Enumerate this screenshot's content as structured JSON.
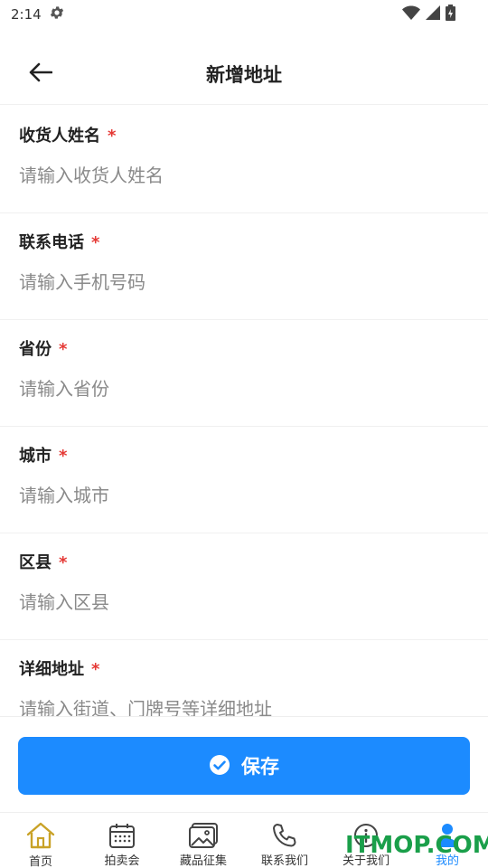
{
  "status_bar": {
    "time": "2:14"
  },
  "header": {
    "title": "新增地址"
  },
  "form": {
    "required_mark": "*",
    "fields": [
      {
        "label": "收货人姓名",
        "placeholder": "请输入收货人姓名",
        "value": ""
      },
      {
        "label": "联系电话",
        "placeholder": "请输入手机号码",
        "value": ""
      },
      {
        "label": "省份",
        "placeholder": "请输入省份",
        "value": ""
      },
      {
        "label": "城市",
        "placeholder": "请输入城市",
        "value": ""
      },
      {
        "label": "区县",
        "placeholder": "请输入区县",
        "value": ""
      },
      {
        "label": "详细地址",
        "placeholder": "请输入街道、门牌号等详细地址",
        "value": ""
      }
    ]
  },
  "save_button": {
    "label": "保存"
  },
  "tab_bar": {
    "tabs": [
      {
        "label": "首页",
        "icon": "home-icon"
      },
      {
        "label": "拍卖会",
        "icon": "calendar-icon"
      },
      {
        "label": "藏品征集",
        "icon": "image-icon"
      },
      {
        "label": "联系我们",
        "icon": "phone-icon"
      },
      {
        "label": "关于我们",
        "icon": "info-icon"
      },
      {
        "label": "我的",
        "icon": "user-icon",
        "active": true
      }
    ]
  },
  "watermark": "ITMOP.COM",
  "colors": {
    "accent": "#1c8bff",
    "required": "#e53935",
    "home_icon": "#c9a227",
    "watermark": "#1a9f4a"
  }
}
